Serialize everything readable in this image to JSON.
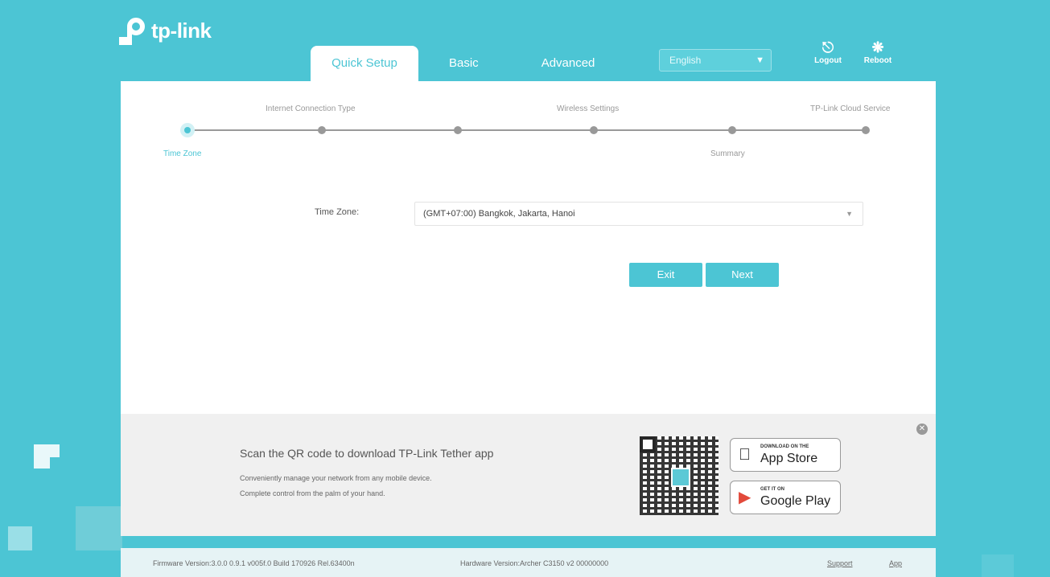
{
  "brand": {
    "name": "tp-link"
  },
  "tabs": [
    {
      "label": "Quick Setup",
      "active": true
    },
    {
      "label": "Basic",
      "active": false
    },
    {
      "label": "Advanced",
      "active": false
    }
  ],
  "language": {
    "selected": "English"
  },
  "header_buttons": {
    "logout": "Logout",
    "reboot": "Reboot"
  },
  "wizard": {
    "steps_top": [
      "Internet Connection Type",
      "Wireless Settings",
      "TP-Link Cloud Service"
    ],
    "steps_bottom": [
      "Time Zone",
      "Summary"
    ],
    "current_step": "Time Zone"
  },
  "form": {
    "time_zone_label": "Time Zone:",
    "time_zone_value": "(GMT+07:00) Bangkok, Jakarta, Hanoi"
  },
  "buttons": {
    "exit": "Exit",
    "next": "Next"
  },
  "promo": {
    "title": "Scan the QR code to download TP-Link Tether app",
    "line1": "Conveniently manage your network from any mobile device.",
    "line2": "Complete control from the palm of your hand.",
    "app_store_small": "DOWNLOAD ON THE",
    "app_store_big": "App Store",
    "google_small": "GET IT ON",
    "google_big": "Google Play"
  },
  "footer": {
    "firmware": "Firmware Version:3.0.0 0.9.1 v005f.0 Build 170926 Rel.63400n",
    "hardware": "Hardware Version:Archer C3150 v2 00000000",
    "support": "Support",
    "app": "App"
  },
  "colors": {
    "accent": "#4cc5d4"
  }
}
